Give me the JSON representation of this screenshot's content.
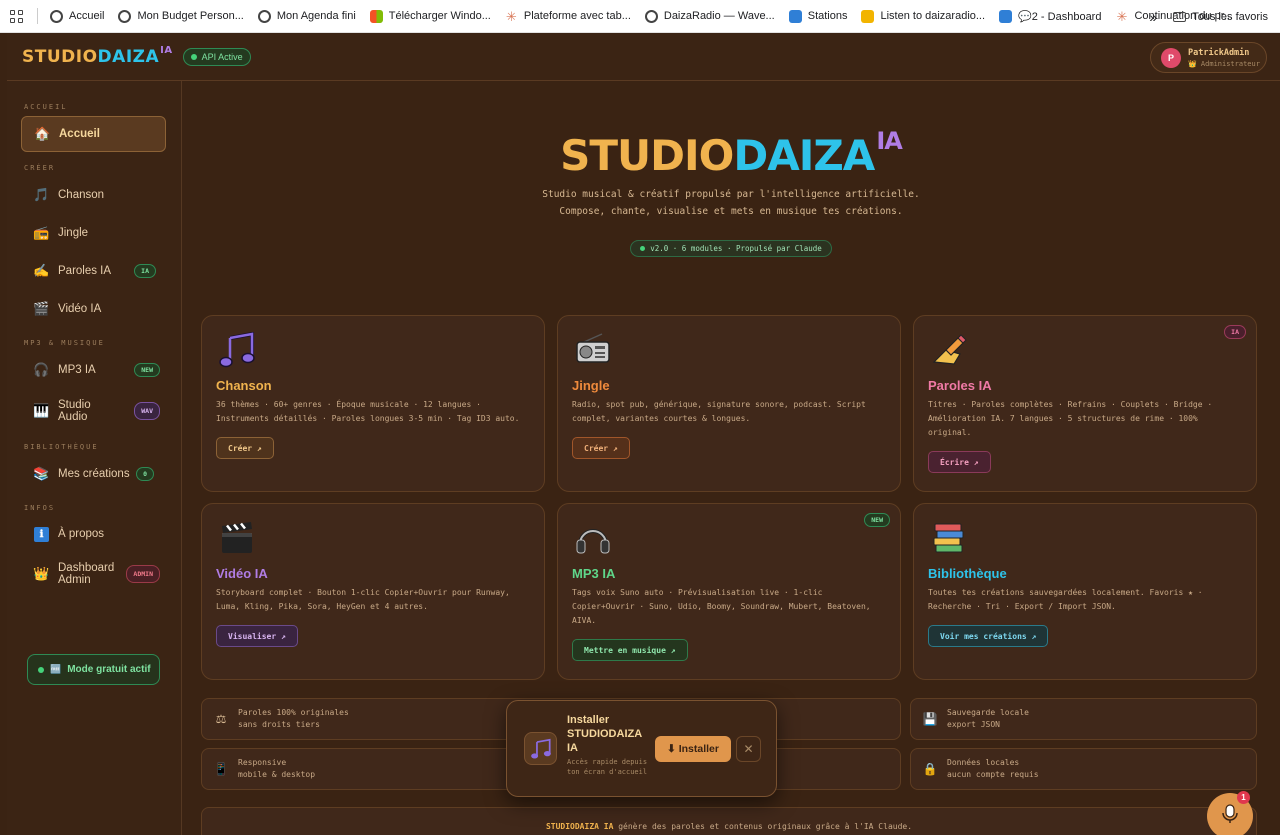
{
  "bookmarks": {
    "items": [
      "Accueil",
      "Mon Budget Person...",
      "Mon Agenda fini",
      "Télécharger Windo...",
      "Plateforme avec tab...",
      "DaizaRadio — Wave...",
      "Stations",
      "Listen to daizaradio...",
      "💬2 - Dashboard",
      "Continuation du pr..."
    ],
    "more": "»",
    "all_favorites": "Tous les favoris"
  },
  "header": {
    "logo_a": "STUDIO",
    "logo_b": "DAIZA",
    "logo_sup": "IA",
    "api_status": "API Active",
    "user_initial": "P",
    "user_name": "PatrickAdmin",
    "user_role": "👑 Administrateur"
  },
  "sidebar": {
    "sections": [
      "ACCUEIL",
      "CRÉER",
      "MP3 & MUSIQUE",
      "BIBLIOTHÈQUE",
      "INFOS"
    ],
    "items": [
      {
        "label": "Accueil",
        "icon": "house-icon",
        "glyph": "🏠"
      },
      {
        "label": "Chanson",
        "icon": "music-note-icon",
        "glyph": "🎵"
      },
      {
        "label": "Jingle",
        "icon": "radio-icon",
        "glyph": "📻"
      },
      {
        "label": "Paroles IA",
        "icon": "writing-icon",
        "glyph": "✍",
        "badge": "IA"
      },
      {
        "label": "Vidéo IA",
        "icon": "clapper-icon",
        "glyph": "🎬"
      },
      {
        "label": "MP3 IA",
        "icon": "headphones-icon",
        "glyph": "🎧",
        "badge": "NEW"
      },
      {
        "label": "Studio Audio",
        "icon": "piano-icon",
        "glyph": "🎹",
        "badge": "WAV"
      },
      {
        "label": "Mes créations",
        "icon": "books-icon",
        "glyph": "📚",
        "badge": "0"
      },
      {
        "label": "À propos",
        "icon": "info-icon",
        "glyph": "ℹ"
      },
      {
        "label": "Dashboard Admin",
        "icon": "crown-icon",
        "glyph": "👑",
        "badge": "ADMIN"
      }
    ],
    "mode_label": "Mode gratuit actif",
    "mode_glyph": "🆓"
  },
  "hero": {
    "title_a": "STUDIO",
    "title_b": "DAIZA",
    "title_sup": "IA",
    "line1": "Studio musical & créatif propulsé par l'intelligence artificielle.",
    "line2": "Compose, chante, visualise et mets en musique tes créations.",
    "pill": "v2.0 · 6 modules · Propulsé par Claude"
  },
  "cards": [
    {
      "title": "Chanson",
      "desc": "36 thèmes · 60+ genres · Époque musicale · 12 langues · Instruments détaillés · Paroles longues 3-5 min · Tag ID3 auto.",
      "button": "Créer ↗",
      "color": "#f0b34e",
      "icon": "music-note-icon",
      "glyph": "🎵"
    },
    {
      "title": "Jingle",
      "desc": "Radio, spot pub, générique, signature sonore, podcast. Script complet, variantes courtes & longues.",
      "button": "Créer ↗",
      "color": "#ef8a3c",
      "icon": "radio-icon",
      "glyph": "📻"
    },
    {
      "title": "Paroles IA",
      "desc": "Titres · Paroles complètes · Refrains · Couplets · Bridge · Amélioration IA. 7 langues · 5 structures de rime · 100% original.",
      "button": "Écrire ↗",
      "color": "#f07aa6",
      "badge": "IA",
      "icon": "writing-icon",
      "glyph": "✍"
    },
    {
      "title": "Vidéo IA",
      "desc": "Storyboard complet · Bouton 1-clic Copier+Ouvrir pour Runway, Luma, Kling, Pika, Sora, HeyGen et 4 autres.",
      "button": "Visualiser ↗",
      "color": "#b07de4",
      "icon": "clapper-icon",
      "glyph": "🎬"
    },
    {
      "title": "MP3 IA",
      "desc": "Tags voix Suno auto · Prévisualisation live · 1-clic Copier+Ouvrir · Suno, Udio, Boomy, Soundraw, Mubert, Beatoven, AIVA.",
      "button": "Mettre en musique ↗",
      "color": "#5fd68a",
      "badge": "NEW",
      "icon": "headphones-icon",
      "glyph": "🎧"
    },
    {
      "title": "Bibliothèque",
      "desc": "Toutes tes créations sauvegardées localement. Favoris ★ · Recherche · Tri · Export / Import JSON.",
      "button": "Voir mes créations ↗",
      "color": "#2ec3ea",
      "icon": "books-icon",
      "glyph": "📚"
    }
  ],
  "features": [
    {
      "line1": "Paroles 100% originales",
      "line2": "sans droits tiers",
      "icon": "scales-icon",
      "glyph": "⚖"
    },
    {
      "line1": "Sauvegarde locale",
      "line2": "export JSON",
      "icon": "floppy-icon",
      "glyph": "💾"
    },
    {
      "line1": "Responsive",
      "line2": "mobile & desktop",
      "icon": "phone-icon",
      "glyph": "📱"
    },
    {
      "line1": "Données locales",
      "line2": "aucun compte requis",
      "icon": "lock-icon",
      "glyph": "🔒"
    }
  ],
  "footer": {
    "brand": "STUDIODAIZA IA",
    "text": " génère des paroles et contenus originaux grâce à l'IA Claude."
  },
  "install": {
    "title": "Installer STUDIODAIZA IA",
    "subtitle": "Accès rapide depuis ton écran d'accueil",
    "button": "⬇ Installer",
    "close": "✕"
  },
  "mic": {
    "count": "1"
  }
}
